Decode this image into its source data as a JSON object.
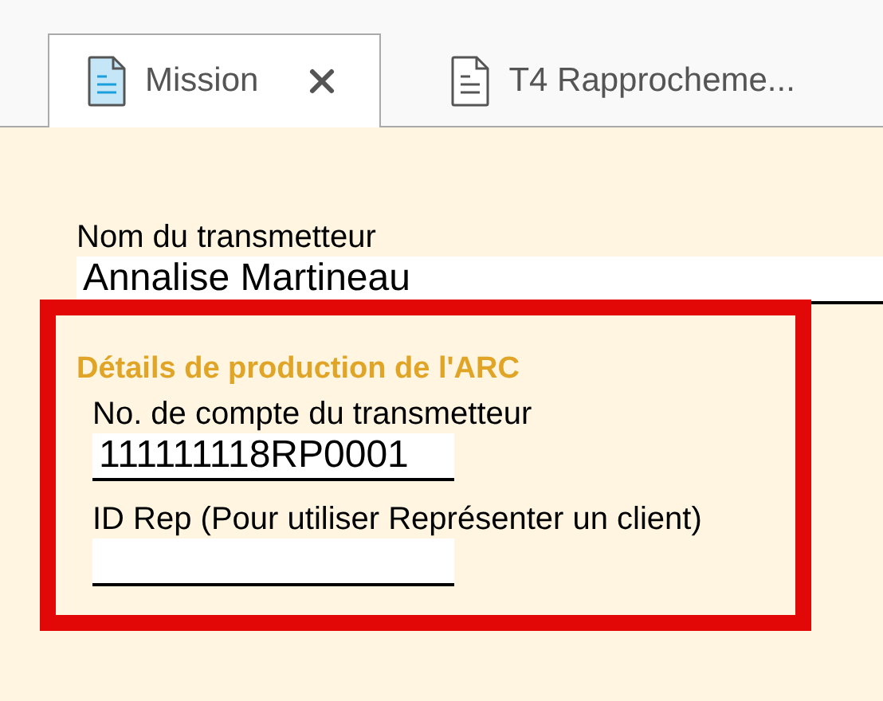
{
  "tabs": [
    {
      "label": "Mission",
      "selected": true,
      "closable": true
    },
    {
      "label": "T4 Rapprocheme...",
      "selected": false,
      "closable": false
    }
  ],
  "form": {
    "name_field": {
      "label": "Nom du transmetteur",
      "value": "Annalise Martineau"
    },
    "section": {
      "title": "Détails de production de l'ARC",
      "highlighted": true,
      "fields": [
        {
          "label": "No. de compte du transmetteur",
          "value": "111111118RP0001"
        },
        {
          "label": "ID Rep (Pour utiliser Représenter un client)"
        }
      ]
    }
  }
}
